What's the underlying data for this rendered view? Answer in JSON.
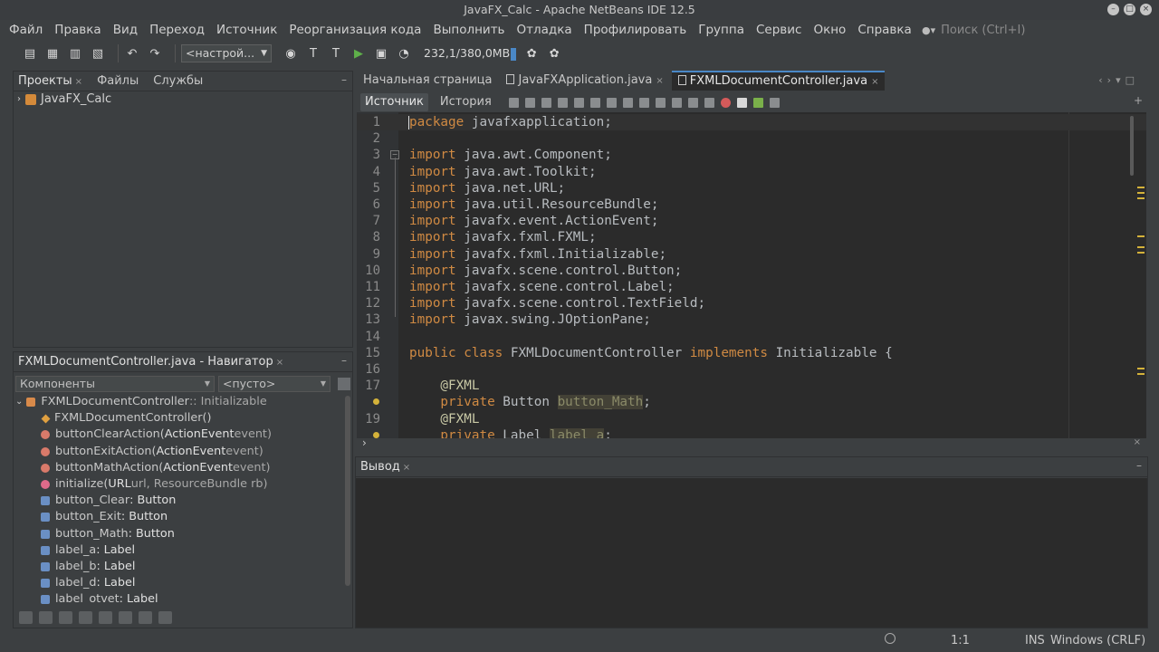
{
  "window": {
    "title": "JavaFX_Calc - Apache NetBeans IDE 12.5"
  },
  "menu": [
    "Файл",
    "Правка",
    "Вид",
    "Переход",
    "Источник",
    "Реорганизация кода",
    "Выполнить",
    "Отладка",
    "Профилировать",
    "Группа",
    "Сервис",
    "Окно",
    "Справка"
  ],
  "search": {
    "placeholder": "Поиск (Ctrl+I)"
  },
  "toolbar": {
    "config": "<настрой...",
    "memory": "232,1/380,0MB"
  },
  "projects_panel": {
    "tabs": [
      "Проекты",
      "Файлы",
      "Службы"
    ],
    "tree": [
      "JavaFX_Calc"
    ]
  },
  "navigator": {
    "title": "FXMLDocumentController.java - Навигатор",
    "filter": "Компоненты",
    "filter2": "<пусто>",
    "rows": [
      {
        "a": "FXMLDocumentController",
        "b": " :: Initializable",
        "c": ""
      },
      {
        "a": "FXMLDocumentController()",
        "b": "",
        "c": ""
      },
      {
        "a": "buttonClearAction(",
        "b": "ActionEvent",
        "c": " event)"
      },
      {
        "a": "buttonExitAction(",
        "b": "ActionEvent",
        "c": " event)"
      },
      {
        "a": "buttonMathAction(",
        "b": "ActionEvent",
        "c": " event)"
      },
      {
        "a": "initialize(",
        "b": "URL",
        "c": " url, ResourceBundle rb)"
      },
      {
        "a": "button_Clear",
        "b": " : Button",
        "c": ""
      },
      {
        "a": "button_Exit",
        "b": " : Button",
        "c": ""
      },
      {
        "a": "button_Math",
        "b": " : Button",
        "c": ""
      },
      {
        "a": "label_a",
        "b": " : Label",
        "c": ""
      },
      {
        "a": "label_b",
        "b": " : Label",
        "c": ""
      },
      {
        "a": "label_d",
        "b": " : Label",
        "c": ""
      },
      {
        "a": "label_otvet",
        "b": " : Label",
        "c": ""
      }
    ]
  },
  "editor": {
    "tabs": [
      "Начальная страница",
      "JavaFXApplication.java",
      "FXMLDocumentController.java"
    ],
    "modes": [
      "Источник",
      "История"
    ],
    "lines": [
      {
        "n": "1",
        "kw": "package",
        "rest": " javafxapplication;"
      },
      {
        "n": "2",
        "kw": "",
        "rest": ""
      },
      {
        "n": "3",
        "kw": "import",
        "rest": " java.awt.Component;"
      },
      {
        "n": "4",
        "kw": "import",
        "rest": " java.awt.Toolkit;"
      },
      {
        "n": "5",
        "kw": "import",
        "rest": " java.net.URL;"
      },
      {
        "n": "6",
        "kw": "import",
        "rest": " java.util.ResourceBundle;"
      },
      {
        "n": "7",
        "kw": "import",
        "rest": " javafx.event.ActionEvent;"
      },
      {
        "n": "8",
        "kw": "import",
        "rest": " javafx.fxml.FXML;"
      },
      {
        "n": "9",
        "kw": "import",
        "rest": " javafx.fxml.Initializable;"
      },
      {
        "n": "10",
        "kw": "import",
        "rest": " javafx.scene.control.Button;"
      },
      {
        "n": "11",
        "kw": "import",
        "rest": " javafx.scene.control.Label;"
      },
      {
        "n": "12",
        "kw": "import",
        "rest": " javafx.scene.control.TextField;"
      },
      {
        "n": "13",
        "kw": "import",
        "rest": " javax.swing.JOptionPane;"
      },
      {
        "n": "14",
        "kw": "",
        "rest": ""
      },
      {
        "n": "15",
        "kw": "public class",
        "rest": " FXMLDocumentController ",
        "kw2": "implements",
        "rest2": " Initializable {"
      },
      {
        "n": "16",
        "kw": "",
        "rest": ""
      },
      {
        "n": "17",
        "ann": "    @FXML"
      },
      {
        "n": "",
        "kw": "    private",
        "rest": " Button ",
        "hl": "button_Math",
        "tail": ";"
      },
      {
        "n": "19",
        "ann": "    @FXML"
      },
      {
        "n": "",
        "kw": "    private",
        "rest": " Label ",
        "hl": "label_a",
        "tail": ";"
      }
    ]
  },
  "output": {
    "title": "Вывод"
  },
  "status": {
    "pos": "1:1",
    "mode": "INS",
    "eol": "Windows (CRLF)"
  }
}
